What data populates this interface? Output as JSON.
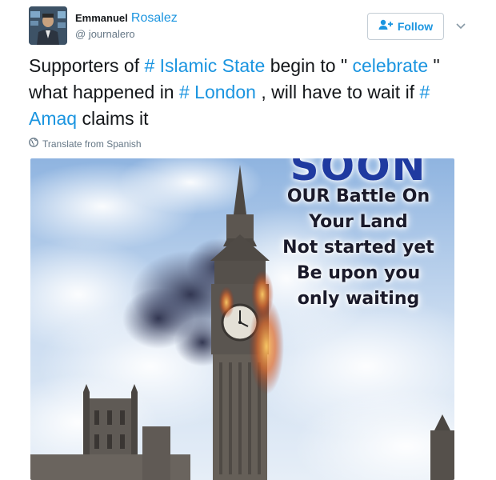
{
  "author": {
    "first_name": "Emmanuel",
    "last_name": "Rosalez",
    "handle": "@ journalero"
  },
  "follow_button": {
    "label": "Follow"
  },
  "tweet": {
    "segments": [
      {
        "text": "Supporters of ",
        "hashtag": false
      },
      {
        "text": "# Islamic State",
        "hashtag": true
      },
      {
        "text": " begin to \" ",
        "hashtag": false
      },
      {
        "text": "celebrate",
        "hashtag": true
      },
      {
        "text": " \" what happened in ",
        "hashtag": false
      },
      {
        "text": "# London",
        "hashtag": true
      },
      {
        "text": " , will have to wait if ",
        "hashtag": false
      },
      {
        "text": "# Amaq",
        "hashtag": true
      },
      {
        "text": " claims it",
        "hashtag": false
      }
    ]
  },
  "translate": {
    "label": "Translate from Spanish"
  },
  "media": {
    "headline": "SOON",
    "lines": [
      "OUR Battle On",
      "Your Land",
      "Not started yet",
      "Be upon you",
      "only waiting"
    ]
  },
  "colors": {
    "link": "#1b95e0",
    "text": "#14171a",
    "muted": "#657786"
  },
  "icons": {
    "follow": "person-add-icon",
    "menu": "chevron-down-icon",
    "translate": "globe-icon"
  }
}
